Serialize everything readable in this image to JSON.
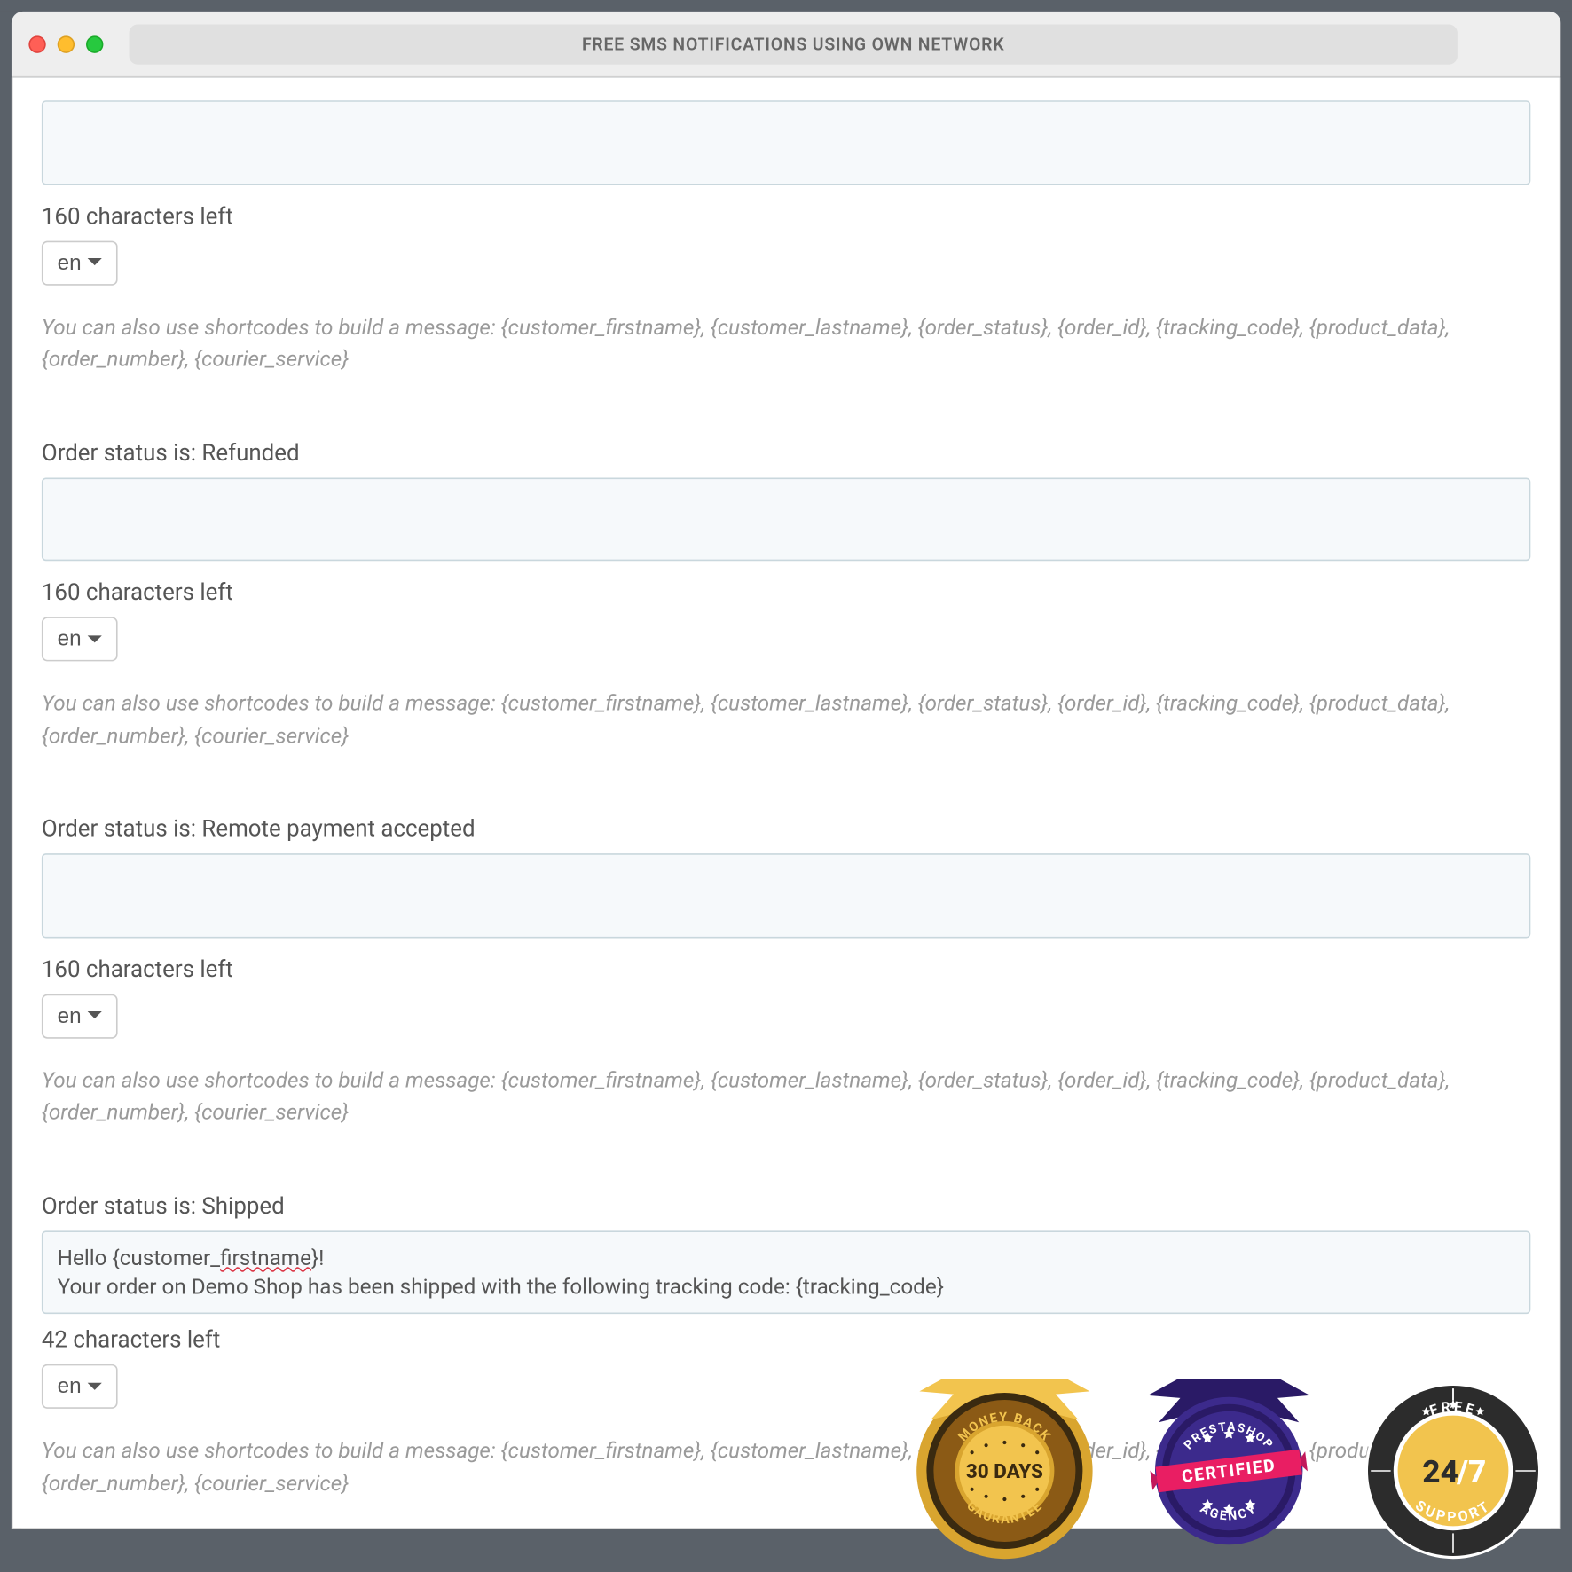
{
  "window": {
    "title": "FREE SMS NOTIFICATIONS USING OWN NETWORK"
  },
  "hint_text": "You can also use shortcodes to build a message: {customer_firstname}, {customer_lastname}, {order_status}, {order_id}, {tracking_code}, {product_data}, {order_number}, {courier_service}",
  "lang": "en",
  "sections": [
    {
      "label": "",
      "value": "",
      "chars_left": "160 characters left"
    },
    {
      "label": "Order status is: Refunded",
      "value": "",
      "chars_left": "160 characters left"
    },
    {
      "label": "Order status is: Remote payment accepted",
      "value": "",
      "chars_left": "160 characters left"
    },
    {
      "label": "Order status is: Shipped",
      "value_pre": "Hello {customer_",
      "value_squiggle": "firstname",
      "value_post": "}!\nYour order on Demo Shop has been shipped with the following tracking code: {tracking_code}",
      "chars_left": "42 characters left"
    }
  ],
  "badges": {
    "moneyback_top": "MONEY BACK",
    "moneyback_mid": "30 DAYS",
    "moneyback_bottom": "GAURANTEE",
    "cert_top": "PRESTASHOP",
    "cert_mid": "CERTIFIED",
    "cert_bottom": "AGENCY",
    "support_top": "FREE",
    "support_mid_a": "24",
    "support_mid_b": "/7",
    "support_bottom": "SUPPORT"
  }
}
